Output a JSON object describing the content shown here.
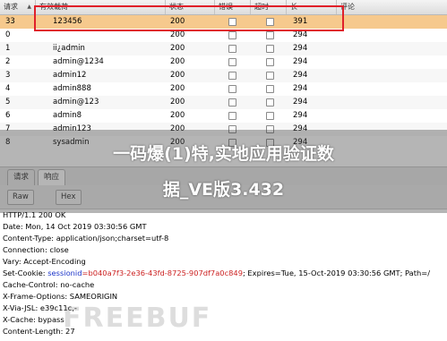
{
  "table": {
    "columns": [
      "请求",
      "有效载荷",
      "状态",
      "错误",
      "超时",
      "长",
      "评论"
    ],
    "sort_indicator": "▲",
    "rows": [
      {
        "req": "33",
        "payload": "123456",
        "status": "200",
        "length": "391",
        "selected": true
      },
      {
        "req": "0",
        "payload": "",
        "status": "200",
        "length": "294"
      },
      {
        "req": "1",
        "payload": "ii¿admin",
        "status": "200",
        "length": "294"
      },
      {
        "req": "2",
        "payload": "admin@1234",
        "status": "200",
        "length": "294"
      },
      {
        "req": "3",
        "payload": "admin12",
        "status": "200",
        "length": "294"
      },
      {
        "req": "4",
        "payload": "admin888",
        "status": "200",
        "length": "294"
      },
      {
        "req": "5",
        "payload": "admin@123",
        "status": "200",
        "length": "294"
      },
      {
        "req": "6",
        "payload": "admin8",
        "status": "200",
        "length": "294"
      },
      {
        "req": "7",
        "payload": "admin123",
        "status": "200",
        "length": "294"
      },
      {
        "req": "8",
        "payload": "sysadmin",
        "status": "200",
        "length": "294"
      }
    ]
  },
  "tabs": {
    "request": "请求",
    "response": "响应"
  },
  "toolbar": {
    "raw": "Raw",
    "hex": "Hex"
  },
  "response": {
    "line0": "HTTP/1.1 200 OK",
    "line1": "Date: Mon, 14 Oct 2019 03:30:56 GMT",
    "line2": "Content-Type: application/json;charset=utf-8",
    "line3": "Connection: close",
    "line4": "Vary: Accept-Encoding",
    "cookie_prefix": "Set-Cookie: ",
    "cookie_name": "sessionid",
    "cookie_value": "=b040a7f3-2e36-43fd-8725-907df7a0c849",
    "cookie_rest": "; Expires=Tue, 15-Oct-2019 03:30:56 GMT; Path=/",
    "line6": "Cache-Control: no-cache",
    "line7": "X-Frame-Options: SAMEORIGIN",
    "line8": "X-Via-JSL: e39c11c,-",
    "line9": "X-Cache: bypass",
    "line10": "Content-Length: 27"
  },
  "banner": {
    "line1": "一码爆(1)特,实地应用验证数",
    "line2": "据_VE版3.432"
  },
  "watermark": "FREEBUF"
}
